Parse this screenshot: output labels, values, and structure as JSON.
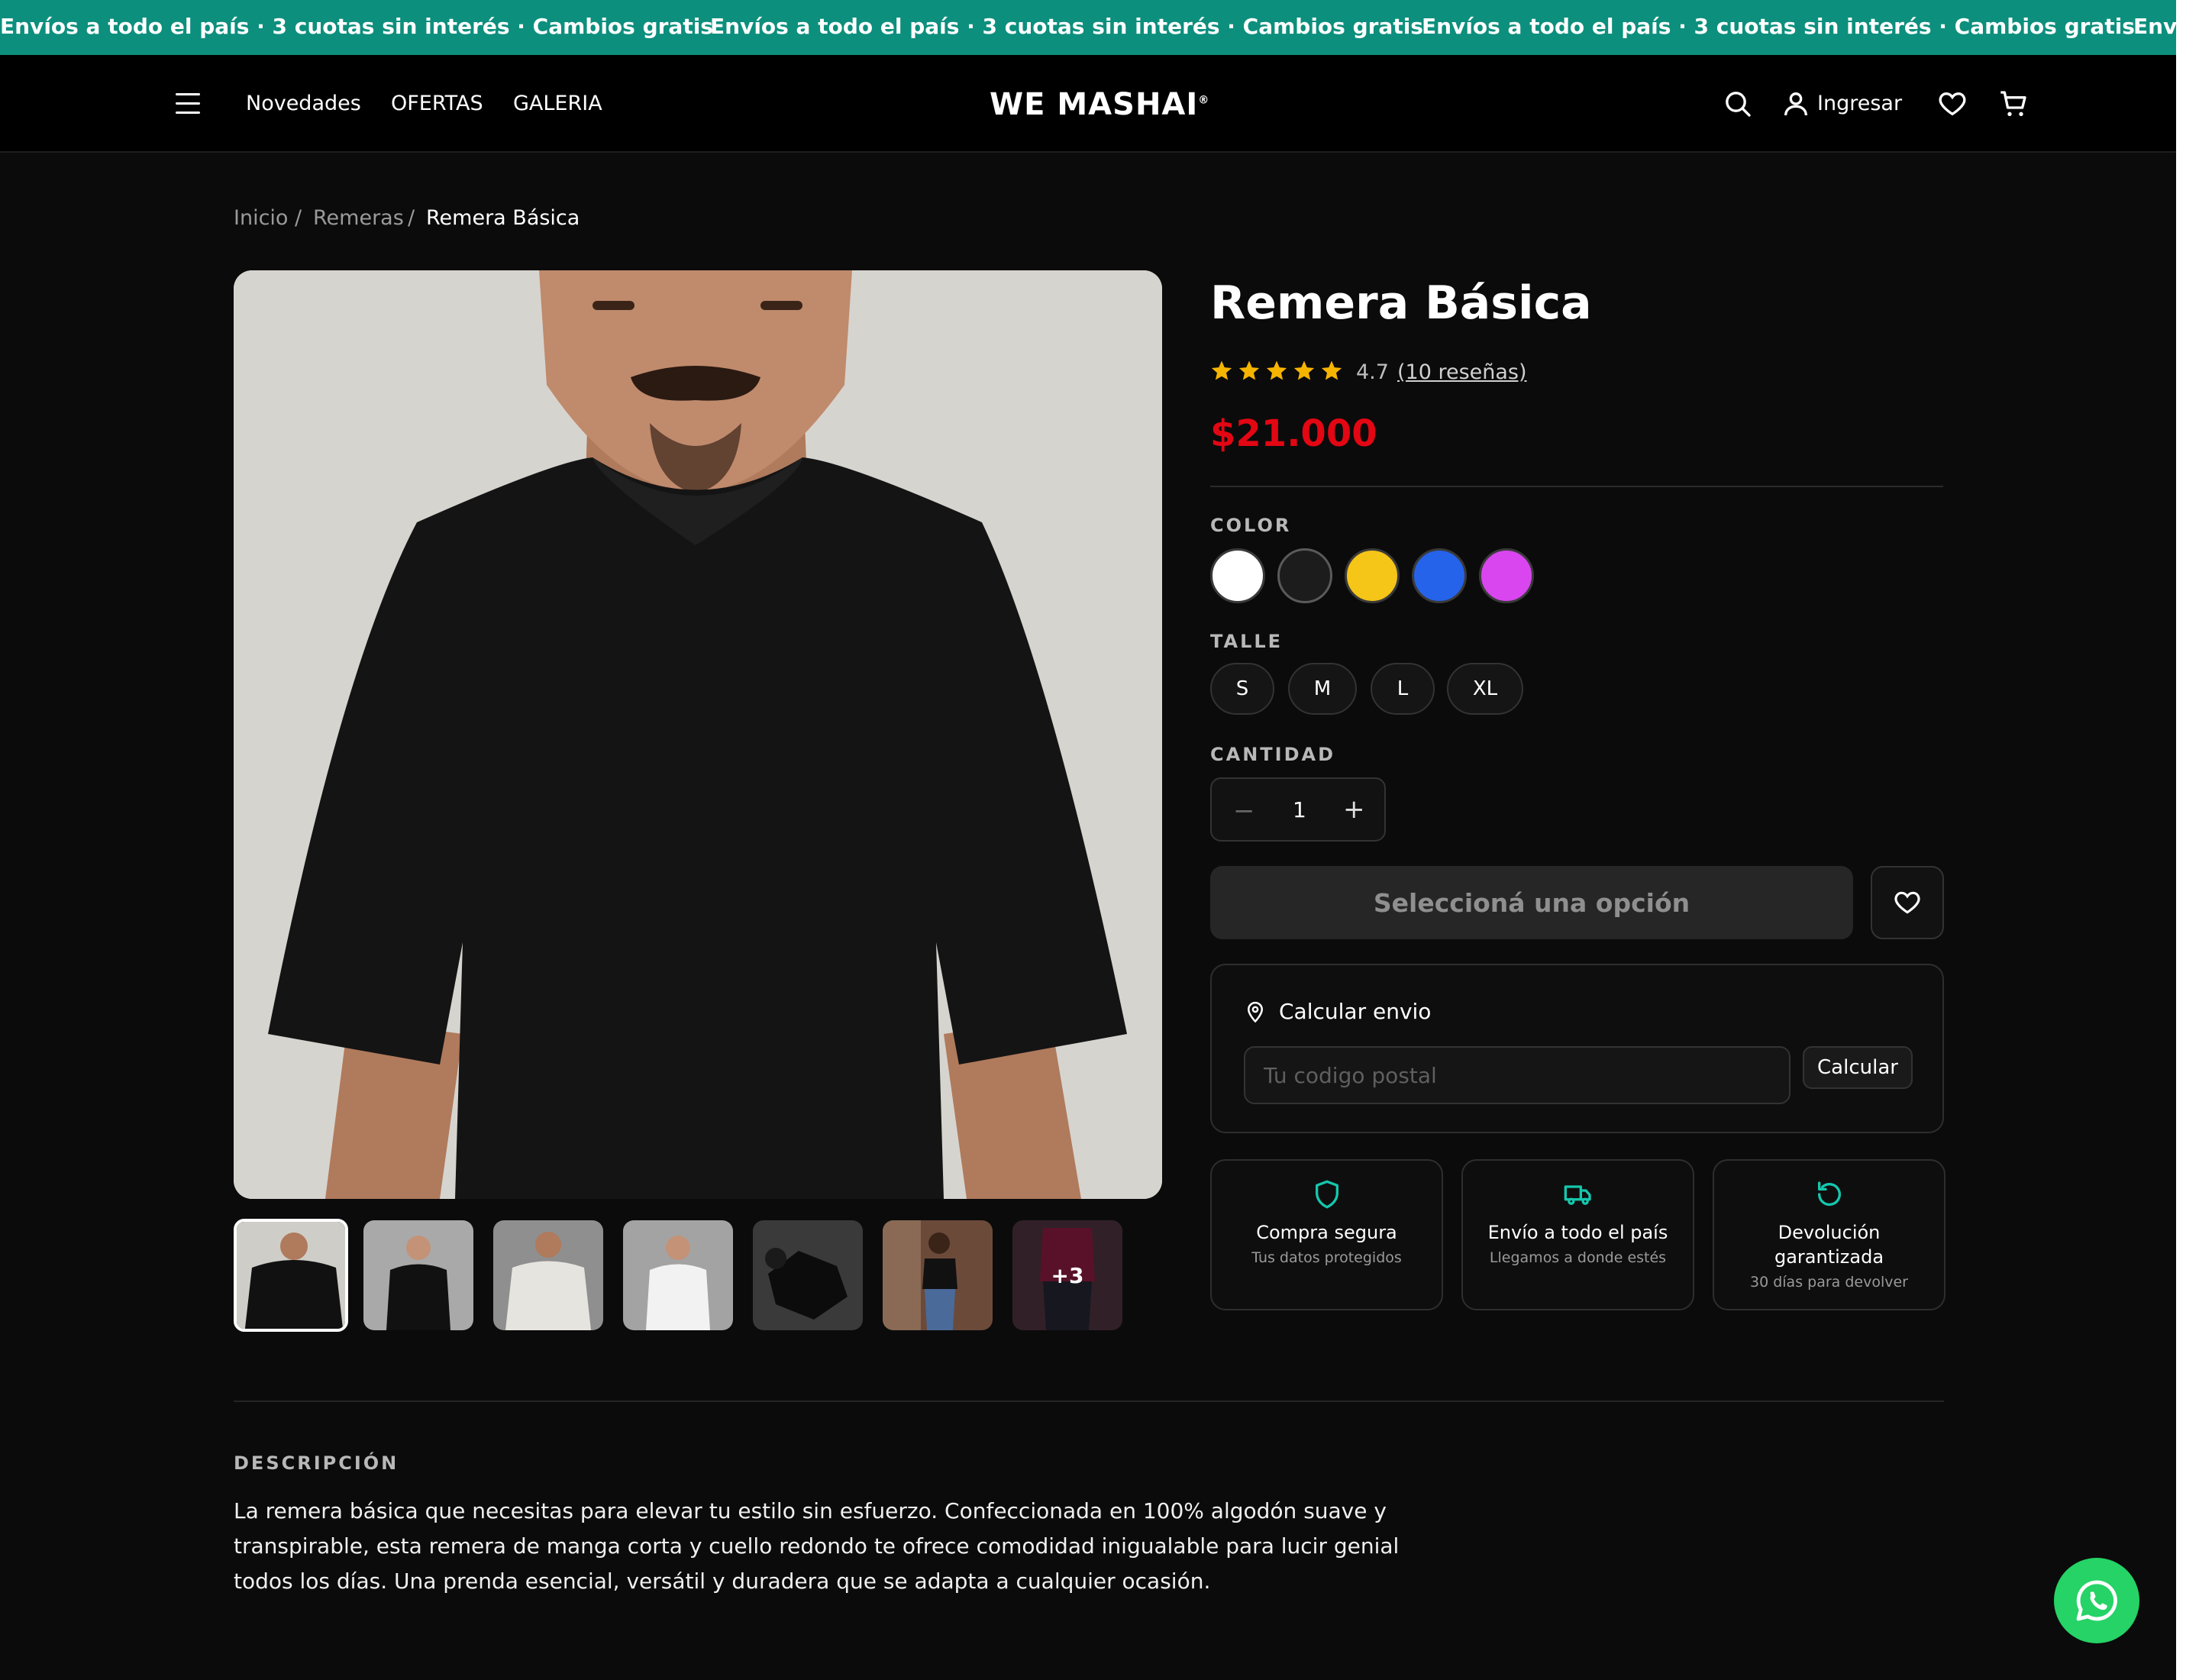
{
  "announcement": {
    "text": "Envíos a todo el país · 3 cuotas sin interés · Cambios gratis",
    "text_cut": "Envío"
  },
  "header": {
    "nav": [
      "Novedades",
      "OFERTAS",
      "GALERIA"
    ],
    "logo": "WE MASHAI",
    "logo_mark": "®",
    "login": "Ingresar"
  },
  "breadcrumb": {
    "items": [
      "Inicio",
      "Remeras",
      "Remera Básica"
    ],
    "separator": "/"
  },
  "gallery": {
    "more_label": "+3",
    "thumbnail_count": 7
  },
  "product": {
    "title": "Remera Básica",
    "rating": "4.7",
    "reviews": "(10 reseñas)",
    "stars": 5,
    "price": "$21.000",
    "color_label": "COLOR",
    "colors": [
      "#ffffff",
      "#1c1c1c",
      "#f5c518",
      "#2563eb",
      "#d946ef"
    ],
    "size_label": "TALLE",
    "sizes": [
      "S",
      "M",
      "L",
      "XL"
    ],
    "qty_label": "CANTIDAD",
    "qty_value": "1",
    "select_button": "Seleccioná una opción"
  },
  "shipping": {
    "title": "Calcular envio",
    "placeholder": "Tu codigo postal",
    "button": "Calcular"
  },
  "features": [
    {
      "icon": "shield-icon",
      "title": "Compra segura",
      "sub": "Tus datos protegidos"
    },
    {
      "icon": "truck-icon",
      "title": "Envío a todo el país",
      "sub": "Llegamos a donde estés"
    },
    {
      "icon": "refresh-icon",
      "title": "Devolución garantizada",
      "sub": "30 días para devolver"
    }
  ],
  "description": {
    "label": "DESCRIPCIÓN",
    "text": "La remera básica que necesitas para elevar tu estilo sin esfuerzo. Confeccionada en 100% algodón suave y transpirable, esta remera de manga corta y cuello redondo te ofrece comodidad inigualable para lucir genial todos los días. Una prenda esencial, versátil y duradera que se adapta a cualquier ocasión."
  },
  "colors": {
    "accent": "#0d8f7d",
    "price": "#e30613",
    "whatsapp": "#25d366",
    "star": "#f5b400"
  }
}
